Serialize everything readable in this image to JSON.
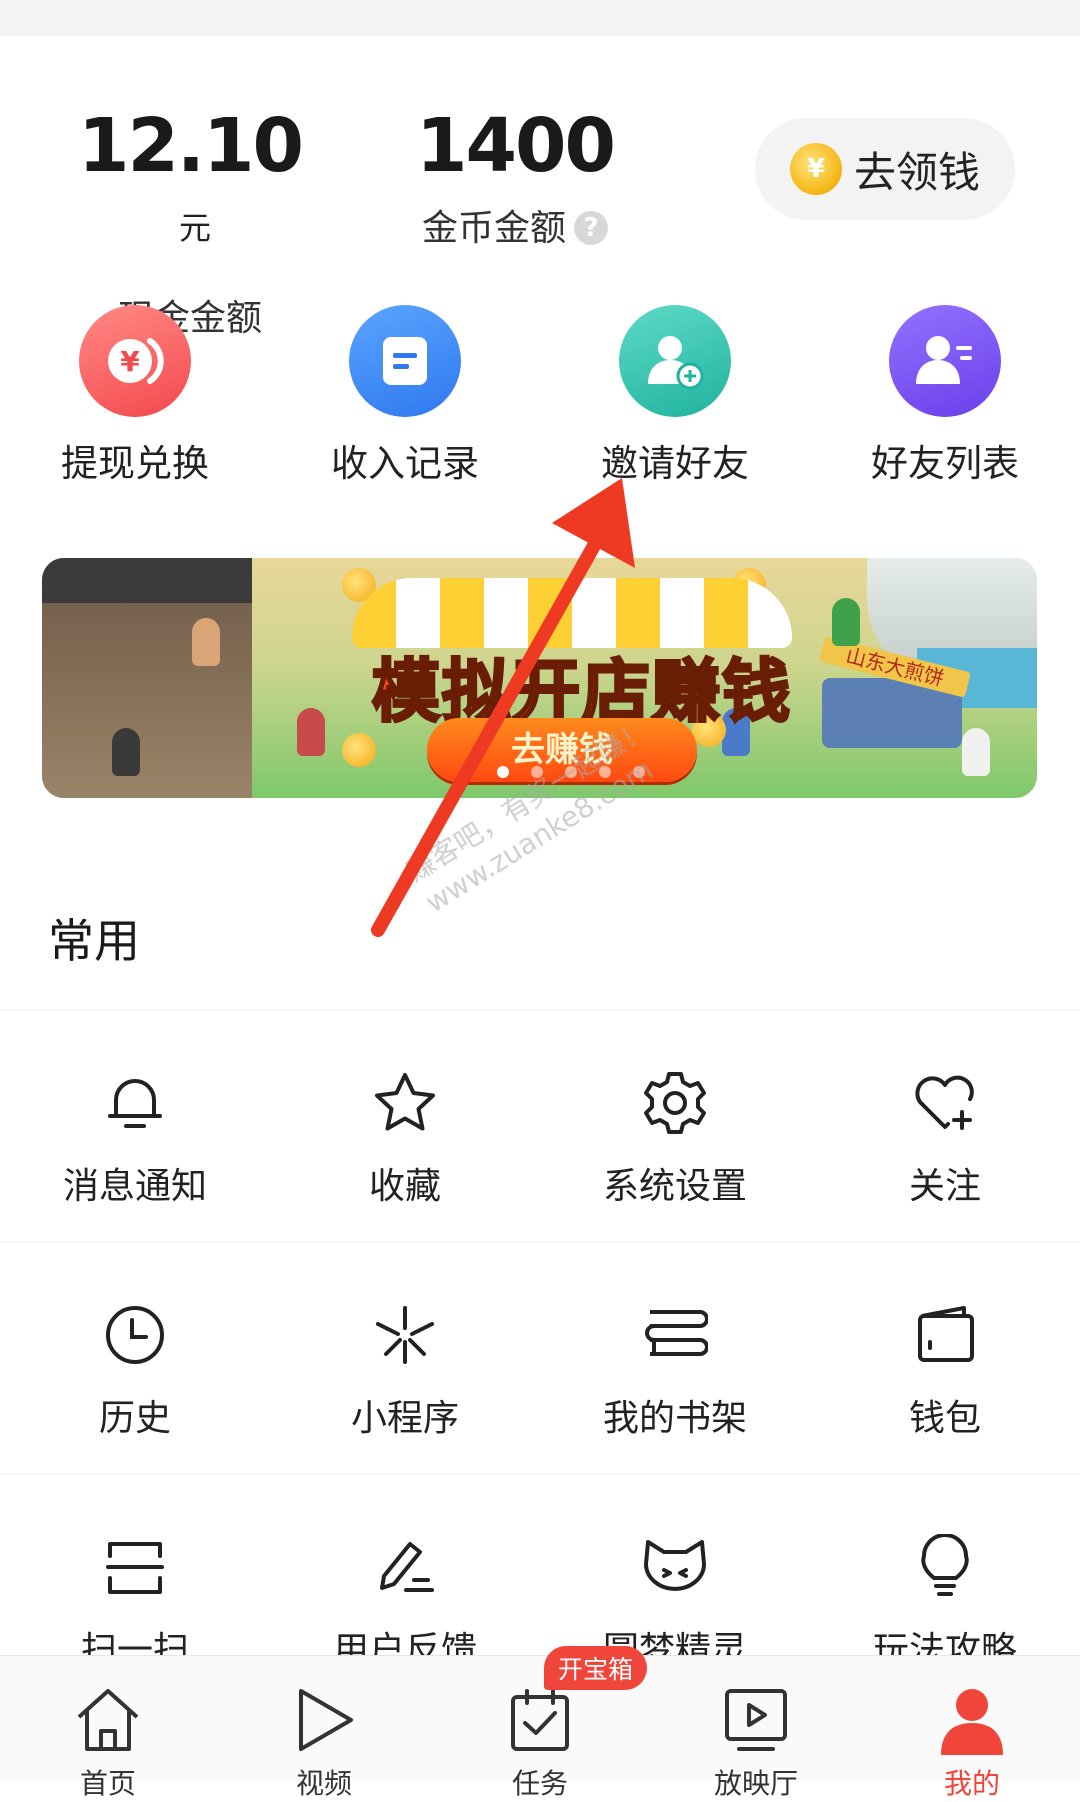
{
  "balance": {
    "cash_value": "12.10",
    "cash_unit": "元",
    "cash_label": "现金金额",
    "coin_value": "1400",
    "coin_label": "金币金额",
    "help_glyph": "?",
    "get_money_label": "去领钱",
    "coin_glyph": "¥"
  },
  "quick_actions": [
    {
      "label": "提现兑换",
      "icon": "yuan-coin-icon",
      "color": "#f7575a"
    },
    {
      "label": "收入记录",
      "icon": "document-icon",
      "color": "#3c8af7"
    },
    {
      "label": "邀请好友",
      "icon": "add-user-icon",
      "color": "#34c3b0"
    },
    {
      "label": "好友列表",
      "icon": "user-list-icon",
      "color": "#7a56f0"
    }
  ],
  "banner": {
    "title": "模拟开店赚钱",
    "button": "去赚钱",
    "shop_sign": "山东大煎饼",
    "carousel_pages": 5,
    "active_page": 1
  },
  "watermark": {
    "line1": "赚客吧，有奖一起赚！",
    "line2": "www.zuanke8.com"
  },
  "section": {
    "title": "常用"
  },
  "grid": [
    [
      {
        "label": "消息通知",
        "icon": "bell-icon"
      },
      {
        "label": "收藏",
        "icon": "star-icon"
      },
      {
        "label": "系统设置",
        "icon": "gear-icon"
      },
      {
        "label": "关注",
        "icon": "heart-plus-icon"
      }
    ],
    [
      {
        "label": "历史",
        "icon": "clock-icon"
      },
      {
        "label": "小程序",
        "icon": "mini-program-icon"
      },
      {
        "label": "我的书架",
        "icon": "bookshelf-icon"
      },
      {
        "label": "钱包",
        "icon": "wallet-icon"
      }
    ],
    [
      {
        "label": "扫一扫",
        "icon": "scan-icon"
      },
      {
        "label": "用户反馈",
        "icon": "pen-icon"
      },
      {
        "label": "圆梦精灵",
        "icon": "cat-face-icon"
      },
      {
        "label": "玩法攻略",
        "icon": "lightbulb-icon"
      }
    ]
  ],
  "bottom_nav": {
    "tabs": [
      {
        "label": "首页",
        "icon": "home-icon"
      },
      {
        "label": "视频",
        "icon": "play-icon"
      },
      {
        "label": "任务",
        "icon": "task-icon"
      },
      {
        "label": "放映厅",
        "icon": "screen-icon"
      },
      {
        "label": "我的",
        "icon": "profile-icon"
      }
    ],
    "task_badge": "开宝箱",
    "active_tab": "我的",
    "active_color": "#f0453b"
  },
  "annotation": {
    "arrow_color": "#ee3a22"
  }
}
